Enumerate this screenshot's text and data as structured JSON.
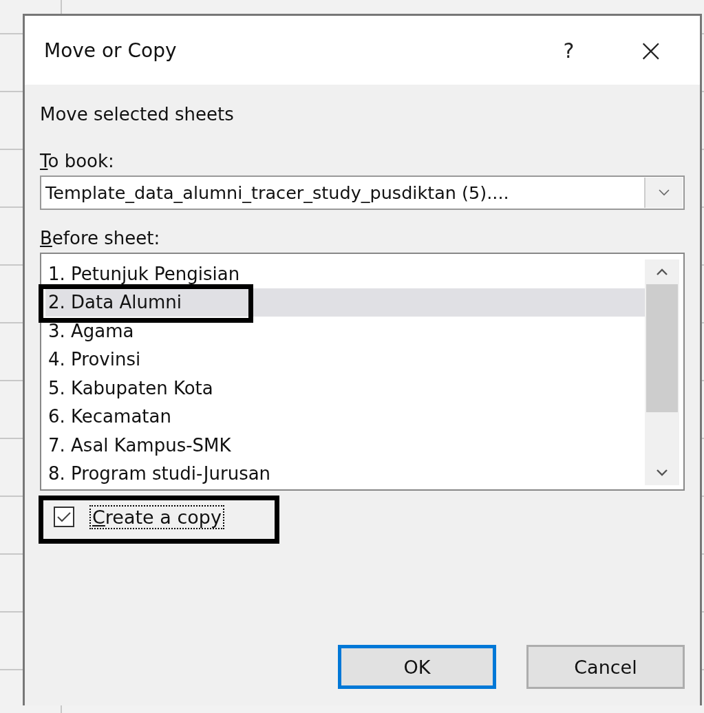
{
  "window": {
    "title": "Move or Copy",
    "help": "?",
    "close": "×"
  },
  "heading": "Move selected sheets",
  "to_book": {
    "label": "To book:",
    "value": "Template_data_alumni_tracer_study_pusdiktan (5)...."
  },
  "before_sheet": {
    "label": "Before sheet:",
    "items": [
      {
        "label": "1. Petunjuk Pengisian",
        "selected": false,
        "highlighted": false
      },
      {
        "label": "2. Data Alumni",
        "selected": true,
        "highlighted": true
      },
      {
        "label": "3. Agama",
        "selected": false,
        "highlighted": false
      },
      {
        "label": "4. Provinsi",
        "selected": false,
        "highlighted": false
      },
      {
        "label": "5. Kabupaten Kota",
        "selected": false,
        "highlighted": false
      },
      {
        "label": "6. Kecamatan",
        "selected": false,
        "highlighted": false
      },
      {
        "label": "7. Asal Kampus-SMK",
        "selected": false,
        "highlighted": false
      },
      {
        "label": "8. Program studi-Jurusan",
        "selected": false,
        "highlighted": false
      }
    ]
  },
  "create_copy": {
    "label": "Create a copy",
    "checked": true,
    "highlighted": true
  },
  "buttons": [
    {
      "label": "OK",
      "default": true
    },
    {
      "label": "Cancel",
      "default": false
    }
  ]
}
